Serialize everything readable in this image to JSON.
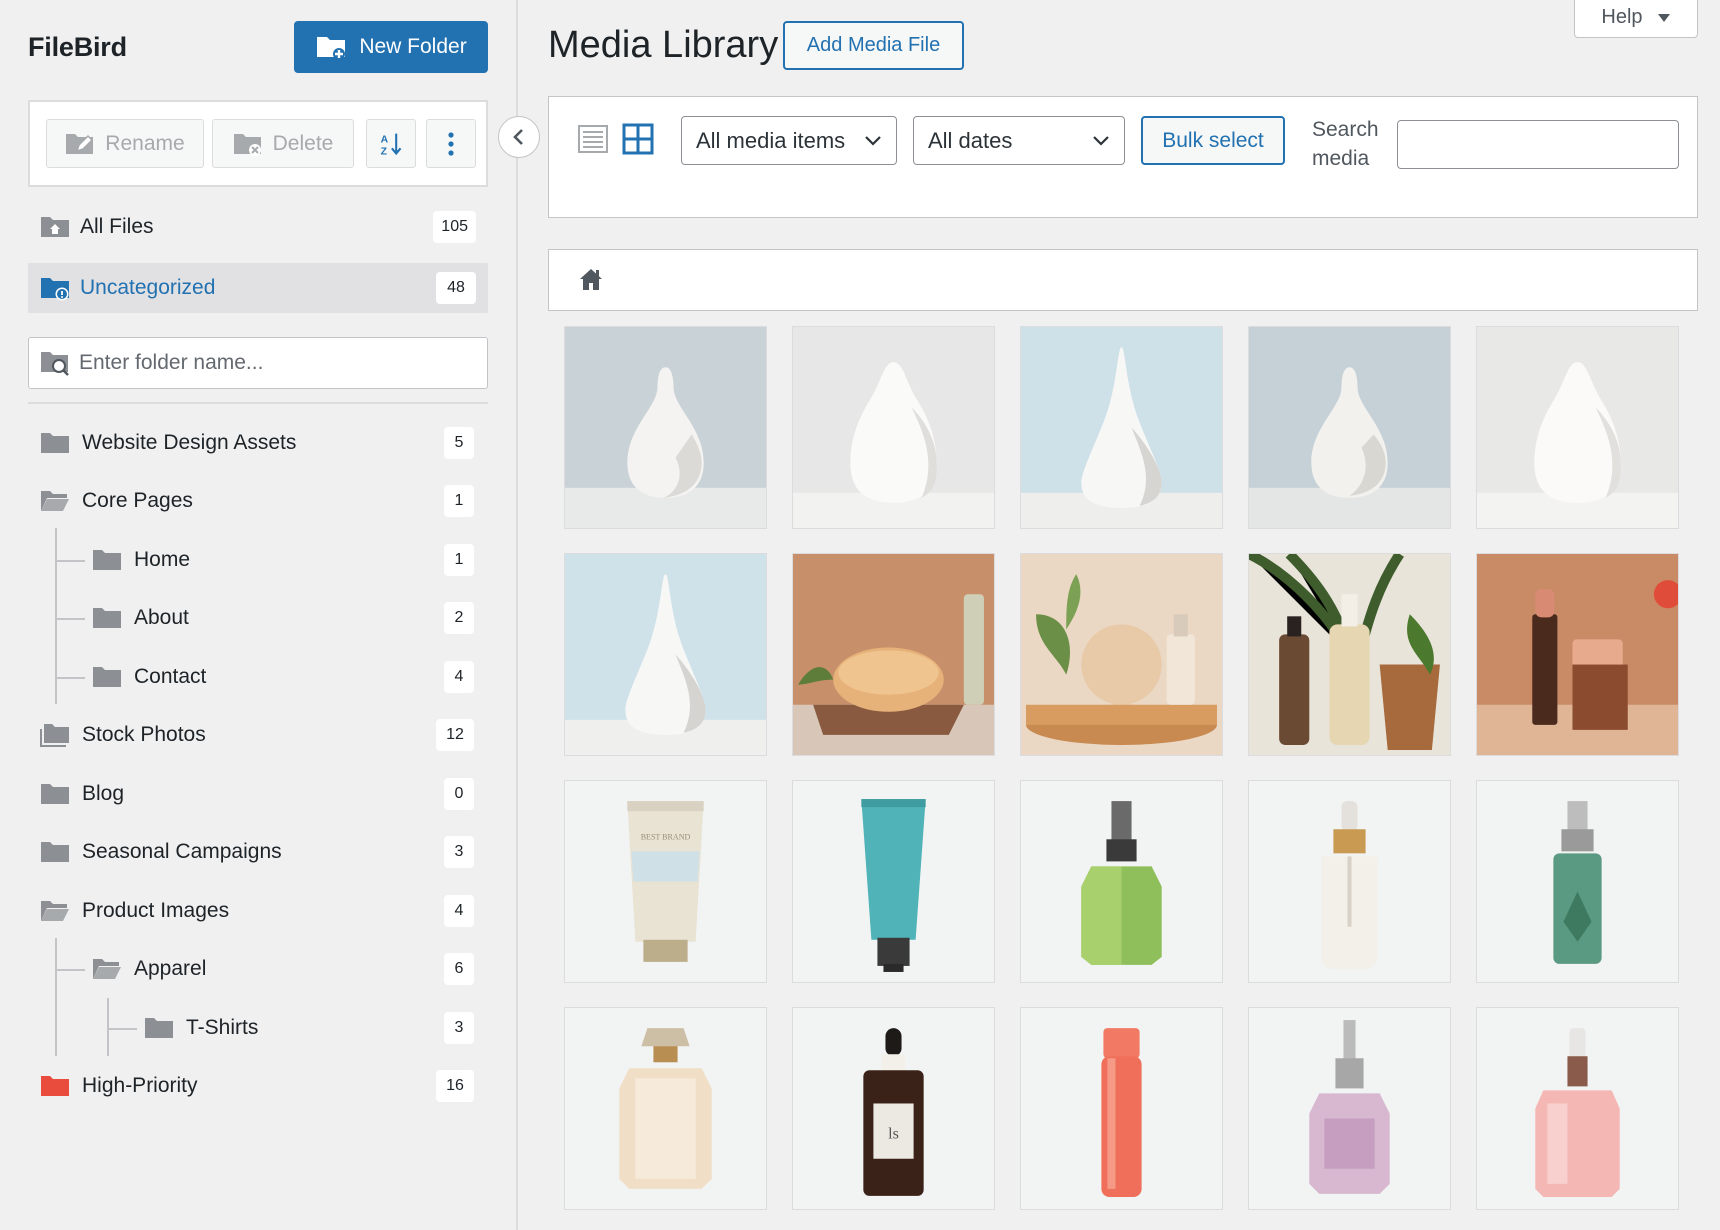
{
  "sidebar": {
    "brand": "FileBird",
    "new_folder_label": "New Folder",
    "rename_label": "Rename",
    "delete_label": "Delete",
    "all_files": {
      "label": "All Files",
      "count": "105"
    },
    "uncategorized": {
      "label": "Uncategorized",
      "count": "48"
    },
    "search_placeholder": "Enter folder name...",
    "folders": [
      {
        "label": "Website Design Assets",
        "count": "5"
      },
      {
        "label": "Core Pages",
        "count": "1"
      },
      {
        "label": "Home",
        "count": "1"
      },
      {
        "label": "About",
        "count": "2"
      },
      {
        "label": "Contact",
        "count": "4"
      },
      {
        "label": "Stock Photos",
        "count": "12"
      },
      {
        "label": "Blog",
        "count": "0"
      },
      {
        "label": "Seasonal Campaigns",
        "count": "3"
      },
      {
        "label": "Product Images",
        "count": "4"
      },
      {
        "label": "Apparel",
        "count": "6"
      },
      {
        "label": "T-Shirts",
        "count": "3"
      },
      {
        "label": "High-Priority",
        "count": "16"
      }
    ]
  },
  "header": {
    "help_label": "Help",
    "title": "Media Library",
    "add_media_label": "Add Media File"
  },
  "filters": {
    "type_selected": "All media items",
    "date_selected": "All dates",
    "bulk_select_label": "Bulk select",
    "search_label": "Search media",
    "search_value": ""
  },
  "colors": {
    "accent": "#2271b1",
    "high_priority_folder": "#e94b3c",
    "folder_gray": "#8c8f94"
  },
  "media_items": [
    "vase-image",
    "vase-image",
    "vase-image",
    "vase-image",
    "vase-image",
    "vase-image",
    "soap-image",
    "cosmetics-image",
    "bottles-image",
    "lipstick-image",
    "tube-image",
    "tube-image",
    "perfume-bottle-image",
    "dropper-bottle-image",
    "perfume-bottle-image",
    "perfume-bottle-image",
    "serum-bottle-image",
    "spray-bottle-image",
    "perfume-bottle-image",
    "serum-bottle-image"
  ]
}
